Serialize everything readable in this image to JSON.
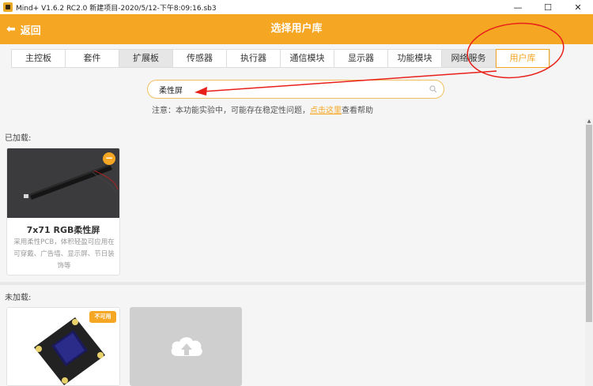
{
  "window": {
    "title": "Mind+ V1.6.2 RC2.0   新建项目-2020/5/12-下午8:09:16.sb3",
    "minimize": "—",
    "maximize": "☐",
    "close": "✕"
  },
  "header": {
    "back_label": "返回",
    "title": "选择用户库"
  },
  "tabs": [
    {
      "label": "主控板",
      "state": "normal"
    },
    {
      "label": "套件",
      "state": "normal"
    },
    {
      "label": "扩展板",
      "state": "gray"
    },
    {
      "label": "传感器",
      "state": "normal"
    },
    {
      "label": "执行器",
      "state": "normal"
    },
    {
      "label": "通信模块",
      "state": "normal"
    },
    {
      "label": "显示器",
      "state": "normal"
    },
    {
      "label": "功能模块",
      "state": "normal"
    },
    {
      "label": "网络服务",
      "state": "gray"
    },
    {
      "label": "用户库",
      "state": "active"
    }
  ],
  "search": {
    "value": "柔性屏",
    "icon": "search-icon"
  },
  "notice": {
    "prefix": "注意：本功能实验中，可能存在稳定性问题，",
    "link": "点击这里",
    "suffix": "查看帮助"
  },
  "loaded": {
    "label": "已加载:",
    "cards": [
      {
        "title": "7x71 RGB柔性屏",
        "description": "采用柔性PCB，体积轻盈可应用在可穿戴、广告墙、显示屏、节日装饰等",
        "badge": "−"
      }
    ]
  },
  "unloaded": {
    "label": "未加载:",
    "cards": [
      {
        "badge": "不可用",
        "image": "oled-module-image"
      },
      {
        "image": "cloud-upload-icon"
      }
    ]
  },
  "colors": {
    "accent": "#f5a623",
    "annotation": "#e8201a"
  }
}
